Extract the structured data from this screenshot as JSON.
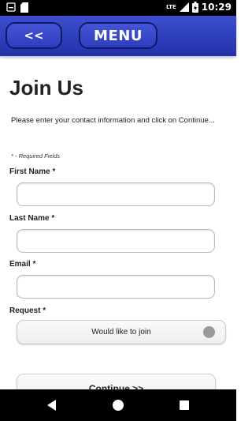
{
  "status_bar": {
    "time": "10:29",
    "network": "LTE",
    "icons": [
      "notification-box-icon",
      "sd-card-icon",
      "signal-icon",
      "battery-icon"
    ]
  },
  "header": {
    "back_label": "<<",
    "menu_label": "MENU",
    "colors": {
      "bar": "#2f3fc0",
      "border": "#111a6a"
    }
  },
  "page": {
    "title": "Join Us",
    "intro": "Please enter your contact information and click on Continue...",
    "required_note": "* - Required Fields"
  },
  "form": {
    "first_name": {
      "label": "First Name *",
      "value": ""
    },
    "last_name": {
      "label": "Last Name *",
      "value": ""
    },
    "email": {
      "label": "Email *",
      "value": ""
    },
    "request": {
      "label": "Request *",
      "selected": "Would like to join"
    },
    "continue_label": "Continue >>"
  },
  "nav_bar": {
    "icons": [
      "back-triangle-icon",
      "home-circle-icon",
      "recents-square-icon"
    ]
  }
}
